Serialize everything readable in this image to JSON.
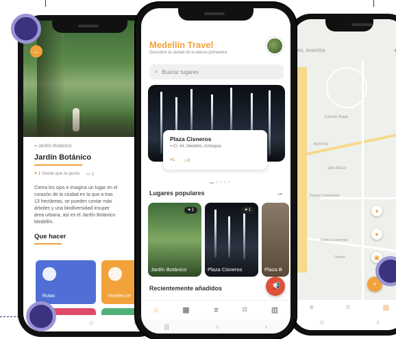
{
  "center": {
    "app_title": "Medellín Travel",
    "app_subtitle": "Descubre la ciudad de la eterna primavera",
    "search_placeholder": "Buscar lugares",
    "featured": {
      "title": "Plaza Cisneros",
      "address": "Cl. 44, Medellín, Antioquia",
      "likes": "1",
      "comments": "0"
    },
    "popular_title": "Lugares populares",
    "popular": [
      {
        "label": "Jardín Botánico",
        "likes": "1"
      },
      {
        "label": "Plaza Cisneros",
        "likes": "1"
      },
      {
        "label": "Plaza B"
      }
    ],
    "recent_title": "Recientemente añadidos",
    "nav_icons": [
      "home-icon",
      "grid-icon",
      "list-icon",
      "bookmark-icon",
      "map-icon"
    ]
  },
  "left": {
    "location_small": "Jardín Botánico",
    "place_title": "Jardín Botánico",
    "meta_likes": "1 Gente que le gusta",
    "meta_comments": "1",
    "description": "Cierra los ojos e imagina un lugar en el\ncorazón de la ciudad en la que a tras\n13 hectáreas, se pueden contar más\nárboles y una biodiversidad insuper\nárea urbana, así es el Jardín Botánico\nMedellín.",
    "section_title": "Que hacer",
    "tiles": [
      {
        "label": "Rutas",
        "color": "#4f6fd6"
      },
      {
        "label": "Hoteles ce",
        "color": "#f2a23a"
      }
    ]
  },
  "right": {
    "search_text": "es, eventos",
    "map_labels": [
      "Estación Rogar",
      "BOSTON",
      "SAN DIEGO",
      "Parque Cementerio",
      "Centro Comercial",
      "Oviedo"
    ]
  },
  "colors": {
    "accent": "#f2a23a",
    "fab_red": "#e0503a",
    "guide": "#3a3380"
  }
}
